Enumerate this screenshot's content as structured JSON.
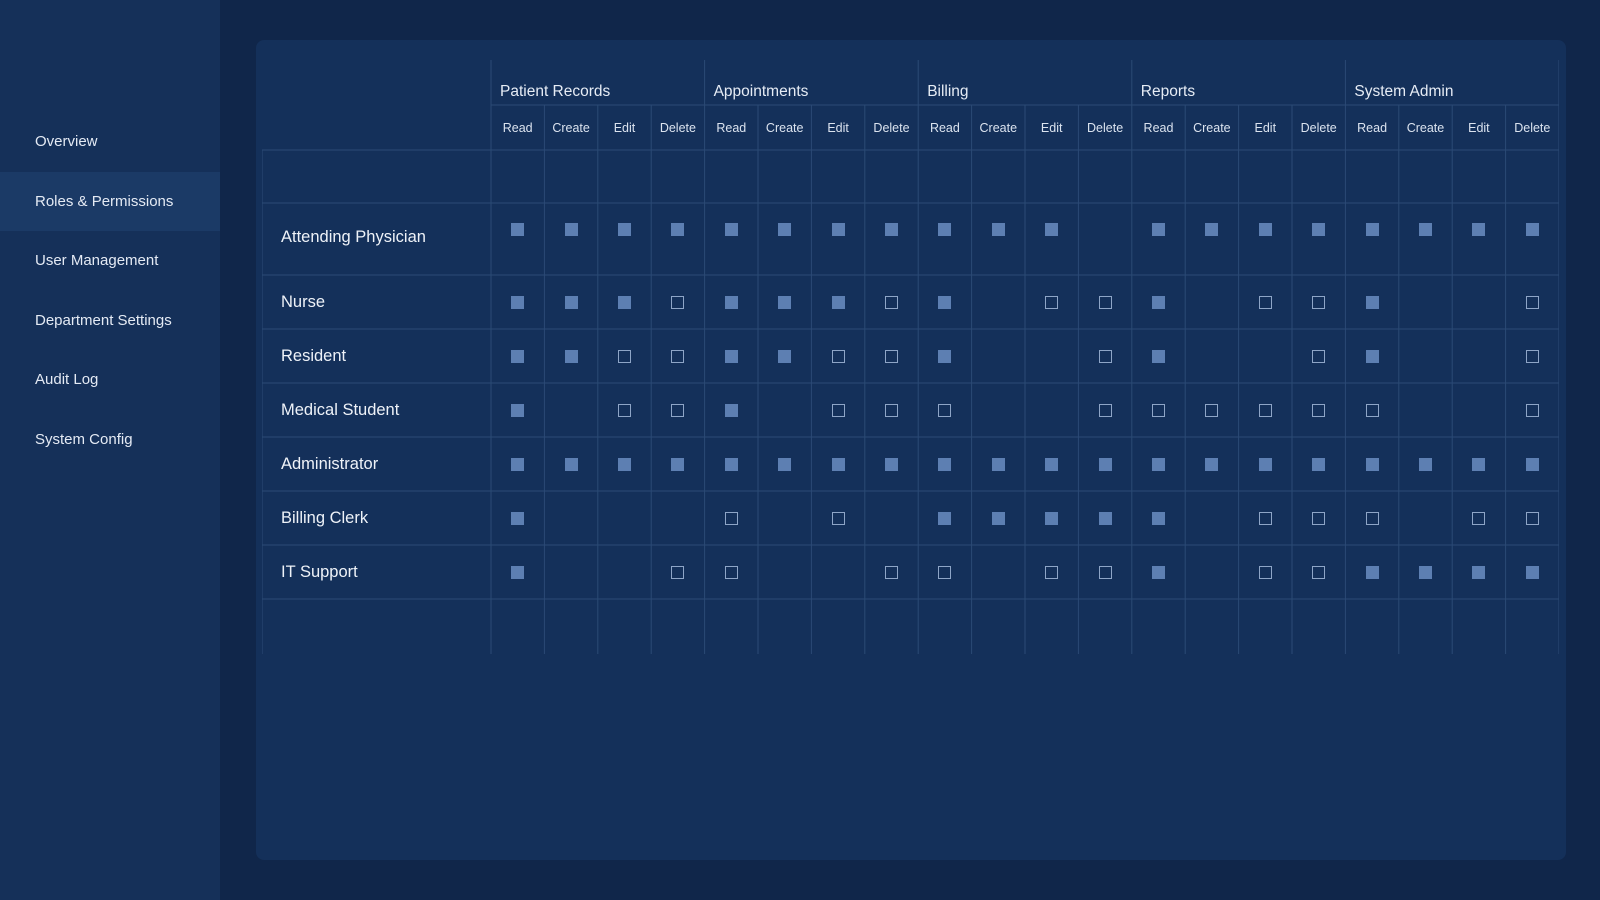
{
  "sidebar": {
    "items": [
      {
        "label": "Overview",
        "active": false
      },
      {
        "label": "Roles & Permissions",
        "active": true
      },
      {
        "label": "User Management",
        "active": false
      },
      {
        "label": "Department Settings",
        "active": false
      },
      {
        "label": "Audit Log",
        "active": false
      },
      {
        "label": "System Config",
        "active": false
      }
    ]
  },
  "matrix": {
    "groups": [
      "Patient Records",
      "Appointments",
      "Billing",
      "Reports",
      "System Admin"
    ],
    "columns": [
      "Read",
      "Create",
      "Edit",
      "Delete"
    ],
    "states_legend": {
      "1": "granted (filled)",
      "0": "not granted (empty box)",
      "null": "not applicable (no box)"
    },
    "roles": [
      {
        "name": "Attending Physician",
        "cells": [
          1,
          1,
          1,
          1,
          1,
          1,
          1,
          1,
          1,
          1,
          1,
          null,
          1,
          1,
          1,
          1,
          1,
          1,
          1,
          1
        ]
      },
      {
        "name": "Nurse",
        "cells": [
          1,
          1,
          1,
          0,
          1,
          1,
          1,
          0,
          1,
          null,
          0,
          0,
          1,
          null,
          0,
          0,
          1,
          null,
          null,
          0
        ]
      },
      {
        "name": "Resident",
        "cells": [
          1,
          1,
          0,
          0,
          1,
          1,
          0,
          0,
          1,
          null,
          null,
          0,
          1,
          null,
          null,
          0,
          1,
          null,
          null,
          0
        ]
      },
      {
        "name": "Medical Student",
        "cells": [
          1,
          null,
          0,
          0,
          1,
          null,
          0,
          0,
          0,
          null,
          null,
          0,
          0,
          0,
          0,
          0,
          0,
          null,
          null,
          0
        ]
      },
      {
        "name": "Administrator",
        "cells": [
          1,
          1,
          1,
          1,
          1,
          1,
          1,
          1,
          1,
          1,
          1,
          1,
          1,
          1,
          1,
          1,
          1,
          1,
          1,
          1
        ]
      },
      {
        "name": "Billing Clerk",
        "cells": [
          1,
          null,
          null,
          null,
          0,
          null,
          0,
          null,
          1,
          1,
          1,
          1,
          1,
          null,
          0,
          0,
          0,
          null,
          0,
          0
        ]
      },
      {
        "name": "IT Support",
        "cells": [
          1,
          null,
          null,
          0,
          0,
          null,
          null,
          0,
          0,
          null,
          0,
          0,
          1,
          null,
          0,
          0,
          1,
          1,
          1,
          1
        ]
      }
    ]
  },
  "colors": {
    "background": "#10264a",
    "sidebar": "#153059",
    "sidebar_active": "#1b3a66",
    "panel": "#14305a",
    "grid_line": "#2b4a75",
    "checkbox_on": "#5d7fb2",
    "checkbox_off_border": "#8ea5c7"
  }
}
